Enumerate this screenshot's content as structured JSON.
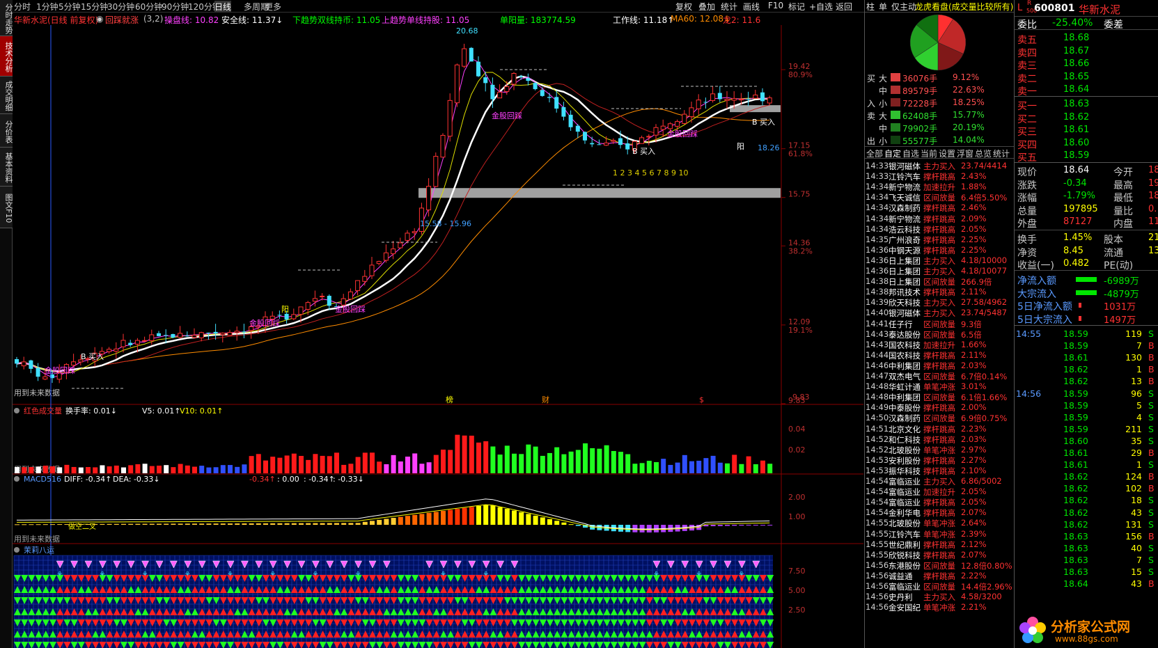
{
  "left_tabs": [
    "分时走势",
    "技术分析",
    "成交明细",
    "分价表",
    "基本资料",
    "图文F10"
  ],
  "periods": [
    {
      "label": "分时",
      "active": false
    },
    {
      "label": "1分钟",
      "active": false
    },
    {
      "label": "5分钟",
      "active": false
    },
    {
      "label": "15分钟",
      "active": false
    },
    {
      "label": "30分钟",
      "active": false
    },
    {
      "label": "60分钟",
      "active": false
    },
    {
      "label": "90分钟",
      "active": false
    },
    {
      "label": "120分钟",
      "active": false
    },
    {
      "label": "日线",
      "active": true
    },
    {
      "label": "多周期",
      "active": false
    },
    {
      "label": "更多",
      "active": false
    }
  ],
  "toolbar_right": [
    "复权",
    "叠加",
    "统计",
    "画线",
    "F10",
    "标记",
    "+自选",
    "返回"
  ],
  "panel_tabs": [
    "柱",
    "单",
    "仅主动",
    "龙虎看盘(成交量比较所有)"
  ],
  "indicator_line": {
    "name": "华新水泥(日线 前复权)",
    "formula": "回踩就涨",
    "params": "(3,2)",
    "cao_pan": "操盘线: 10.82",
    "anquan": "安全线: 11.37↓",
    "down_trend": "下趋势双线持币: 11.05",
    "up_trend": "上趋势单线持股: 11.05",
    "danyang": "单阳量: 183774.59",
    "gongzuo": "工作线: 11.18↑",
    "ma60": "MA60: 12.08↓",
    "long2": "龙2: 11.6"
  },
  "main_chart_labels": {
    "peak": "20.68",
    "range_label": "15.58 - 15.96",
    "buy_b": "B 买入",
    "buy_b2": "B 买入",
    "buy_b3": "B 买入",
    "value_1826": "18.26",
    "counter": "1 2 3 4 5 6 7 8 9 10",
    "fire1": "金股回踩",
    "fire2": "金股回踩",
    "fire3": "金股回踩",
    "fire4": "金股回踩",
    "fire5": "金股回踩",
    "yang1": "阳",
    "yang2": "阳",
    "wei_lai": "用到未来数据",
    "base_val": "9.83",
    "bang": "榜",
    "cai": "财",
    "dollar": "$"
  },
  "price_axis": [
    {
      "price": "19.42",
      "pct": "80.9%"
    },
    {
      "price": "17.15",
      "pct": "61.8%"
    },
    {
      "price": "15.75",
      "pct": ""
    },
    {
      "price": "14.36",
      "pct": "38.2%"
    },
    {
      "price": "12.09",
      "pct": "19.1%"
    },
    {
      "price": "9.83",
      "pct": ""
    }
  ],
  "volume_pane": {
    "title": "红色成交量",
    "turnover": "换手率: 0.01↓",
    "v5": "V5: 0.01↑",
    "v10": "V10: 0.01↑",
    "axis": [
      "0.04",
      "0.02"
    ],
    "note": "用到未来数据"
  },
  "macd_pane": {
    "title": "MACD516",
    "diff": "DIFF: -0.34↑",
    "dea": "DEA: -0.33↓",
    "v1": "-0.34↑",
    "v2": ": 0.00",
    "v3": ": -0.34↑",
    "v4": ": -0.33↓",
    "axis": [
      "2.00",
      "1.00"
    ],
    "note": "用到未来数据",
    "cross_label": "做空二叉"
  },
  "jasmine_pane": {
    "title": "茉莉八运",
    "axis": [
      "7.50",
      "5.00",
      "2.50"
    ]
  },
  "flows": [
    {
      "side": "买",
      "size": "大",
      "hands": "36076手",
      "pct": "9.12%",
      "color": "#e04040"
    },
    {
      "side": "",
      "size": "中",
      "hands": "89579手",
      "pct": "22.63%",
      "color": "#b03030"
    },
    {
      "side": "入",
      "size": "小",
      "hands": "72228手",
      "pct": "18.25%",
      "color": "#802020"
    },
    {
      "side": "卖",
      "size": "大",
      "hands": "62408手",
      "pct": "15.77%",
      "color": "#30c030"
    },
    {
      "side": "",
      "size": "中",
      "hands": "79902手",
      "pct": "20.19%",
      "color": "#208020"
    },
    {
      "side": "出",
      "size": "小",
      "hands": "55577手",
      "pct": "14.04%",
      "color": "#104010"
    }
  ],
  "pie": [
    {
      "pct": 9.12,
      "color": "#ff3030"
    },
    {
      "pct": 22.63,
      "color": "#c02828"
    },
    {
      "pct": 18.25,
      "color": "#801818"
    },
    {
      "pct": 15.77,
      "color": "#30d030"
    },
    {
      "pct": 20.19,
      "color": "#20a020"
    },
    {
      "pct": 14.04,
      "color": "#107010"
    }
  ],
  "alert_tabs": [
    "全部",
    "自定",
    "自选",
    "当前",
    "设置",
    "浮窗",
    "总览",
    "统计"
  ],
  "alerts": [
    {
      "time": "14:33",
      "name": "银河磁体",
      "type": "主力买入",
      "val": "23.74/4414",
      "color": "red"
    },
    {
      "time": "14:33",
      "name": "江铃汽车",
      "type": "撑杆跳高",
      "val": "2.43%",
      "color": "red"
    },
    {
      "time": "14:34",
      "name": "新宁物流",
      "type": "加速拉升",
      "val": "1.88%",
      "color": "red"
    },
    {
      "time": "14:34",
      "name": "飞天诚信",
      "type": "区间放量",
      "val": "6.4倍5.50%",
      "color": "red"
    },
    {
      "time": "14:34",
      "name": "汉森制药",
      "type": "撑杆跳高",
      "val": "2.46%",
      "color": "red"
    },
    {
      "time": "14:34",
      "name": "新宁物流",
      "type": "撑杆跳高",
      "val": "2.09%",
      "color": "red"
    },
    {
      "time": "14:34",
      "name": "浩云科技",
      "type": "撑杆跳高",
      "val": "2.05%",
      "color": "red"
    },
    {
      "time": "14:35",
      "name": "广州浪奇",
      "type": "撑杆跳高",
      "val": "2.25%",
      "color": "red"
    },
    {
      "time": "14:36",
      "name": "中钢天源",
      "type": "撑杆跳高",
      "val": "2.25%",
      "color": "red"
    },
    {
      "time": "14:36",
      "name": "日上集团",
      "type": "主力买入",
      "val": "4.18/10000",
      "color": "red"
    },
    {
      "time": "14:36",
      "name": "日上集团",
      "type": "主力买入",
      "val": "4.18/10077",
      "color": "red"
    },
    {
      "time": "14:38",
      "name": "日上集团",
      "type": "区间放量",
      "val": "266.9倍",
      "color": "red"
    },
    {
      "time": "14:38",
      "name": "邦讯技术",
      "type": "撑杆跳高",
      "val": "2.11%",
      "color": "red"
    },
    {
      "time": "14:39",
      "name": "欣天科技",
      "type": "主力买入",
      "val": "27.58/4962",
      "color": "red"
    },
    {
      "time": "14:40",
      "name": "银河磁体",
      "type": "主力买入",
      "val": "23.74/5487",
      "color": "red"
    },
    {
      "time": "14:41",
      "name": "任子行",
      "type": "区间放量",
      "val": "9.3倍",
      "color": "red"
    },
    {
      "time": "14:43",
      "name": "泰达股份",
      "type": "区间放量",
      "val": "6.5倍",
      "color": "red"
    },
    {
      "time": "14:43",
      "name": "国农科技",
      "type": "加速拉升",
      "val": "1.66%",
      "color": "red"
    },
    {
      "time": "14:44",
      "name": "国农科技",
      "type": "撑杆跳高",
      "val": "2.11%",
      "color": "red"
    },
    {
      "time": "14:46",
      "name": "中利集团",
      "type": "撑杆跳高",
      "val": "2.03%",
      "color": "red"
    },
    {
      "time": "14:47",
      "name": "双杰电气",
      "type": "区间放量",
      "val": "6.7倍0.14%",
      "color": "red"
    },
    {
      "time": "14:48",
      "name": "华虹计通",
      "type": "单笔冲涨",
      "val": "3.01%",
      "color": "red"
    },
    {
      "time": "14:48",
      "name": "中利集团",
      "type": "区间放量",
      "val": "6.1倍1.66%",
      "color": "red"
    },
    {
      "time": "14:49",
      "name": "中泰股份",
      "type": "撑杆跳高",
      "val": "2.00%",
      "color": "red"
    },
    {
      "time": "14:50",
      "name": "汉森制药",
      "type": "区间放量",
      "val": "6.9倍0.75%",
      "color": "red"
    },
    {
      "time": "14:51",
      "name": "北京文化",
      "type": "撑杆跳高",
      "val": "2.23%",
      "color": "red"
    },
    {
      "time": "14:52",
      "name": "和仁科技",
      "type": "撑杆跳高",
      "val": "2.03%",
      "color": "red"
    },
    {
      "time": "14:52",
      "name": "北玻股份",
      "type": "单笔冲涨",
      "val": "2.97%",
      "color": "red"
    },
    {
      "time": "14:53",
      "name": "安利股份",
      "type": "撑杆跳高",
      "val": "2.27%",
      "color": "red"
    },
    {
      "time": "14:53",
      "name": "振华科技",
      "type": "撑杆跳高",
      "val": "2.10%",
      "color": "red"
    },
    {
      "time": "14:54",
      "name": "富临运业",
      "type": "主力买入",
      "val": "6.86/5002",
      "color": "red"
    },
    {
      "time": "14:54",
      "name": "富临运业",
      "type": "加速拉升",
      "val": "2.05%",
      "color": "red"
    },
    {
      "time": "14:54",
      "name": "富临运业",
      "type": "撑杆跳高",
      "val": "2.05%",
      "color": "red"
    },
    {
      "time": "14:54",
      "name": "金利华电",
      "type": "撑杆跳高",
      "val": "2.07%",
      "color": "red"
    },
    {
      "time": "14:55",
      "name": "北玻股份",
      "type": "单笔冲涨",
      "val": "2.64%",
      "color": "red"
    },
    {
      "time": "14:55",
      "name": "江铃汽车",
      "type": "单笔冲涨",
      "val": "2.39%",
      "color": "red"
    },
    {
      "time": "14:55",
      "name": "世纪鼎利",
      "type": "撑杆跳高",
      "val": "2.12%",
      "color": "red"
    },
    {
      "time": "14:55",
      "name": "欣锐科技",
      "type": "撑杆跳高",
      "val": "2.07%",
      "color": "red"
    },
    {
      "time": "14:56",
      "name": "东港股份",
      "type": "区间放量",
      "val": "12.8倍0.80%",
      "color": "red"
    },
    {
      "time": "14:56",
      "name": "诚益通",
      "type": "撑杆跳高",
      "val": "2.22%",
      "color": "red"
    },
    {
      "time": "14:56",
      "name": "富临运业",
      "type": "区间放量",
      "val": "14.4倍2.96%",
      "color": "red"
    },
    {
      "time": "14:56",
      "name": "史丹利",
      "type": "主力买入",
      "val": "4.58/3200",
      "color": "red"
    },
    {
      "time": "14:56",
      "name": "金安国纪",
      "type": "单笔冲涨",
      "val": "2.21%",
      "color": "red"
    }
  ],
  "quote": {
    "flag": "L",
    "r_label": "R",
    "num_label": "500",
    "code": "600801",
    "name": "华新水泥",
    "weibi_label": "委比",
    "weibi": "-25.40%",
    "weicha_label": "委差",
    "asks": [
      {
        "label": "卖五",
        "price": "18.68"
      },
      {
        "label": "卖四",
        "price": "18.67"
      },
      {
        "label": "卖三",
        "price": "18.66"
      },
      {
        "label": "卖二",
        "price": "18.65"
      },
      {
        "label": "卖一",
        "price": "18.64"
      }
    ],
    "bids": [
      {
        "label": "买一",
        "price": "18.63"
      },
      {
        "label": "买二",
        "price": "18.62"
      },
      {
        "label": "买三",
        "price": "18.61"
      },
      {
        "label": "买四",
        "price": "18.60"
      },
      {
        "label": "买五",
        "price": "18.59"
      }
    ],
    "stats": [
      {
        "l1": "现价",
        "v1": "18.64",
        "c1": "white",
        "l2": "今开",
        "v2": "18"
      },
      {
        "l1": "涨跌",
        "v1": "-0.34",
        "c1": "green",
        "l2": "最高",
        "v2": "19"
      },
      {
        "l1": "涨幅",
        "v1": "-1.79%",
        "c1": "green",
        "l2": "最低",
        "v2": "18"
      },
      {
        "l1": "总量",
        "v1": "197895",
        "c1": "yellow",
        "l2": "量比",
        "v2": "0."
      },
      {
        "l1": "外盘",
        "v1": "87127",
        "c1": "red",
        "l2": "内盘",
        "v2": "110"
      }
    ],
    "stats2": [
      {
        "l1": "换手",
        "v1": "1.45%",
        "l2": "股本",
        "v2": "21."
      },
      {
        "l1": "净资",
        "v1": "8.45",
        "l2": "流通",
        "v2": "13."
      },
      {
        "l1": "收益(一)",
        "v1": "0.482",
        "l2": "PE(动)",
        "v2": ""
      }
    ],
    "flows": [
      {
        "label": "净流入额",
        "val": "-6989万",
        "unit": "-",
        "bar_color": "#00e600",
        "val_color": "green"
      },
      {
        "label": "大宗流入",
        "val": "-4879万",
        "unit": "-",
        "bar_color": "#00e600",
        "val_color": "green"
      },
      {
        "label": "5日净流入额",
        "val": "1031万",
        "unit": "",
        "bar_color": "#ff3232",
        "val_color": "red"
      },
      {
        "label": "5日大宗流入",
        "val": "1497万",
        "unit": "",
        "bar_color": "#ff3232",
        "val_color": "red"
      }
    ]
  },
  "ticks": [
    {
      "time": "14:55",
      "price": "18.59",
      "vol": "119",
      "side": "S"
    },
    {
      "time": "",
      "price": "18.59",
      "vol": "7",
      "side": "B"
    },
    {
      "time": "",
      "price": "18.61",
      "vol": "130",
      "side": "B"
    },
    {
      "time": "",
      "price": "18.62",
      "vol": "1",
      "side": "B"
    },
    {
      "time": "",
      "price": "18.62",
      "vol": "13",
      "side": "B"
    },
    {
      "time": "14:56",
      "price": "18.59",
      "vol": "96",
      "side": "S"
    },
    {
      "time": "",
      "price": "18.59",
      "vol": "5",
      "side": "S"
    },
    {
      "time": "",
      "price": "18.59",
      "vol": "4",
      "side": "S"
    },
    {
      "time": "",
      "price": "18.59",
      "vol": "211",
      "side": "S"
    },
    {
      "time": "",
      "price": "18.60",
      "vol": "35",
      "side": "S"
    },
    {
      "time": "",
      "price": "18.61",
      "vol": "29",
      "side": "B"
    },
    {
      "time": "",
      "price": "18.61",
      "vol": "1",
      "side": "S"
    },
    {
      "time": "",
      "price": "18.62",
      "vol": "124",
      "side": "B"
    },
    {
      "time": "",
      "price": "18.62",
      "vol": "102",
      "side": "B"
    },
    {
      "time": "",
      "price": "18.62",
      "vol": "18",
      "side": "S"
    },
    {
      "time": "",
      "price": "18.62",
      "vol": "43",
      "side": "S"
    },
    {
      "time": "",
      "price": "18.62",
      "vol": "131",
      "side": "S"
    },
    {
      "time": "",
      "price": "18.63",
      "vol": "156",
      "side": "B"
    },
    {
      "time": "",
      "price": "18.63",
      "vol": "40",
      "side": "S"
    },
    {
      "time": "",
      "price": "18.63",
      "vol": "7",
      "side": "S"
    },
    {
      "time": "",
      "price": "18.63",
      "vol": "15",
      "side": "S"
    },
    {
      "time": "",
      "price": "18.64",
      "vol": "43",
      "side": "B"
    }
  ],
  "watermark": {
    "text": "分析家公式网",
    "url": "www.88gs.com"
  },
  "chart_data": {
    "type": "candlestick",
    "title": "华新水泥(日线 前复权)",
    "price_range": [
      9.83,
      20.68
    ],
    "peak": 20.68,
    "last_close": 18.64,
    "marked_levels": [
      19.42,
      17.15,
      15.75,
      14.36,
      12.09,
      9.83
    ],
    "support_zone": [
      15.58,
      15.96
    ]
  }
}
